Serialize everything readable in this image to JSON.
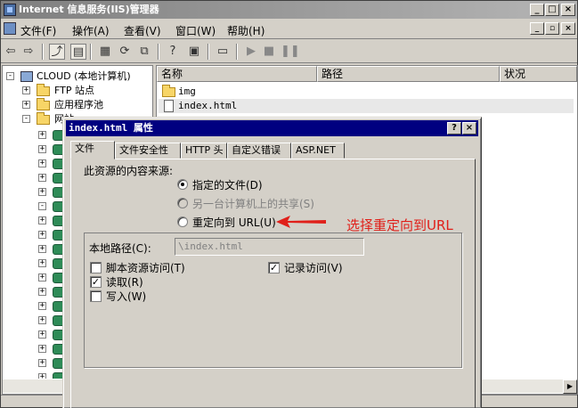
{
  "window": {
    "title": "Internet 信息服务(IIS)管理器"
  },
  "menu": [
    "文件(F)",
    "操作(A)",
    "查看(V)",
    "窗口(W)",
    "帮助(H)"
  ],
  "tree": {
    "root": "CLOUD (本地计算机)",
    "items": [
      "FTP 站点",
      "应用程序池",
      "网站"
    ]
  },
  "list": {
    "columns": [
      "名称",
      "路径",
      "状况"
    ],
    "rows": [
      {
        "name": "img",
        "icon": "folder-icon"
      },
      {
        "name": "index.html",
        "icon": "file-icon"
      }
    ]
  },
  "dialog": {
    "title": "index.html 属性",
    "tabs": [
      "文件",
      "文件安全性",
      "HTTP 头",
      "自定义错误",
      "ASP.NET"
    ],
    "source_label": "此资源的内容来源:",
    "radios": [
      {
        "label": "指定的文件(D)",
        "checked": true,
        "disabled": false
      },
      {
        "label": "另一台计算机上的共享(S)",
        "checked": false,
        "disabled": true
      },
      {
        "label": "重定向到 URL(U)",
        "checked": false,
        "disabled": false
      }
    ],
    "local_path_label": "本地路径(C):",
    "local_path_value": "\\index.html",
    "checkboxes": [
      {
        "label": "脚本资源访问(T)",
        "checked": false
      },
      {
        "label": "读取(R)",
        "checked": true
      },
      {
        "label": "写入(W)",
        "checked": false
      },
      {
        "label": "记录访问(V)",
        "checked": true
      }
    ]
  },
  "annotation": {
    "text": "选择重定向到URL",
    "color": "#e0201a"
  }
}
